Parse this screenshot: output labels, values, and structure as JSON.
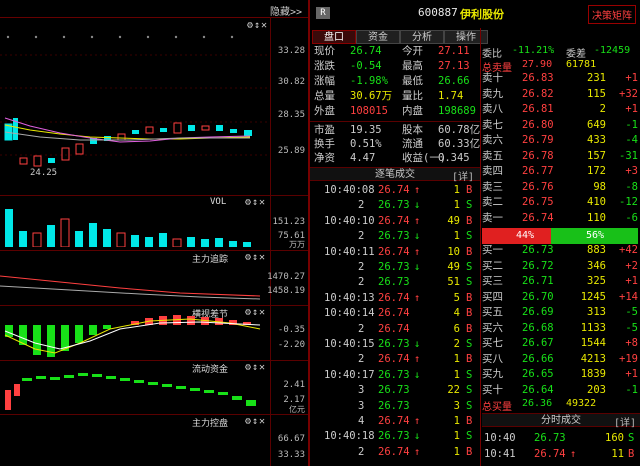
{
  "topbar": {
    "hide_label": "隐藏>>",
    "r_badge": "R",
    "stock_code": "600887",
    "stock_name": "伊利股份",
    "decision_button": "决策矩阵"
  },
  "tabs": [
    "盘口",
    "资金",
    "分析",
    "操作"
  ],
  "left": {
    "price_axis": [
      "33.28",
      "30.82",
      "28.35",
      "25.89"
    ],
    "low_marker": "24.25",
    "vol_title": "VOL",
    "vol_axis": [
      "151.23",
      "75.61"
    ],
    "vol_unit": "万万",
    "p1_title": "主力追踪",
    "p1_axis": [
      "1470.27",
      "1458.19"
    ],
    "p2_title": "横视差节",
    "p2_axis": [
      "-0.35",
      "-2.20"
    ],
    "p3_title": "流动资金",
    "p3_axis": [
      "2.41",
      "2.17"
    ],
    "p3_unit": "亿元",
    "p4_title": "主力控盘",
    "p4_axis": [
      "66.67",
      "33.33"
    ]
  },
  "quote": [
    {
      "l1": "现价",
      "v1": "26.74",
      "c1": "green",
      "l2": "今开",
      "v2": "27.11",
      "c2": "red"
    },
    {
      "l1": "涨跌",
      "v1": "-0.54",
      "c1": "green",
      "l2": "最高",
      "v2": "27.13",
      "c2": "red"
    },
    {
      "l1": "涨幅",
      "v1": "-1.98%",
      "c1": "green",
      "l2": "最低",
      "v2": "26.66",
      "c2": "green"
    },
    {
      "l1": "总量",
      "v1": "30.67万",
      "c1": "yellow",
      "l2": "量比",
      "v2": "1.74",
      "c2": "yellow"
    },
    {
      "l1": "外盘",
      "v1": "108015",
      "c1": "red",
      "l2": "内盘",
      "v2": "198689",
      "c2": "green"
    }
  ],
  "quote2": [
    {
      "l1": "市盈",
      "v1": "19.35",
      "l2": "股本",
      "v2": "60.78亿"
    },
    {
      "l1": "换手",
      "v1": "0.51%",
      "l2": "流通",
      "v2": "60.33亿"
    },
    {
      "l1": "净资",
      "v1": "4.47",
      "l2": "收益(一)",
      "v2": "0.345"
    }
  ],
  "ticks_title": "逐笔成交",
  "ticks_detail": "[详]",
  "ticks": [
    {
      "t": "10:40:08",
      "p": "26.74",
      "a": "↑",
      "v": "1",
      "s": "B",
      "pc": "red",
      "sc": "red"
    },
    {
      "t": "2",
      "p": "26.73",
      "a": "↓",
      "v": "1",
      "s": "S",
      "pc": "green",
      "sc": "green"
    },
    {
      "t": "10:40:10",
      "p": "26.74",
      "a": "↑",
      "v": "49",
      "s": "B",
      "pc": "red",
      "sc": "red"
    },
    {
      "t": "2",
      "p": "26.73",
      "a": "↓",
      "v": "1",
      "s": "S",
      "pc": "green",
      "sc": "green"
    },
    {
      "t": "10:40:11",
      "p": "26.74",
      "a": "↑",
      "v": "10",
      "s": "B",
      "pc": "red",
      "sc": "red"
    },
    {
      "t": "2",
      "p": "26.73",
      "a": "↓",
      "v": "49",
      "s": "S",
      "pc": "green",
      "sc": "green"
    },
    {
      "t": "2",
      "p": "26.73",
      "a": "",
      "v": "51",
      "s": "S",
      "pc": "green",
      "sc": "green"
    },
    {
      "t": "10:40:13",
      "p": "26.74",
      "a": "↑",
      "v": "5",
      "s": "B",
      "pc": "red",
      "sc": "red"
    },
    {
      "t": "10:40:14",
      "p": "26.74",
      "a": "",
      "v": "4",
      "s": "B",
      "pc": "red",
      "sc": "red"
    },
    {
      "t": "2",
      "p": "26.74",
      "a": "",
      "v": "6",
      "s": "B",
      "pc": "red",
      "sc": "red"
    },
    {
      "t": "10:40:15",
      "p": "26.73",
      "a": "↓",
      "v": "2",
      "s": "S",
      "pc": "green",
      "sc": "green"
    },
    {
      "t": "2",
      "p": "26.74",
      "a": "↑",
      "v": "1",
      "s": "B",
      "pc": "red",
      "sc": "red"
    },
    {
      "t": "10:40:17",
      "p": "26.73",
      "a": "↓",
      "v": "1",
      "s": "S",
      "pc": "green",
      "sc": "green"
    },
    {
      "t": "3",
      "p": "26.73",
      "a": "",
      "v": "22",
      "s": "S",
      "pc": "green",
      "sc": "green"
    },
    {
      "t": "3",
      "p": "26.73",
      "a": "",
      "v": "3",
      "s": "S",
      "pc": "green",
      "sc": "green"
    },
    {
      "t": "4",
      "p": "26.74",
      "a": "↑",
      "v": "1",
      "s": "B",
      "pc": "red",
      "sc": "red"
    },
    {
      "t": "10:40:18",
      "p": "26.73",
      "a": "↓",
      "v": "1",
      "s": "S",
      "pc": "green",
      "sc": "green"
    },
    {
      "t": "2",
      "p": "26.74",
      "a": "↑",
      "v": "1",
      "s": "B",
      "pc": "red",
      "sc": "red"
    }
  ],
  "book_header": {
    "l1": "委比",
    "v1": "-11.21%",
    "l2": "委差",
    "v2": "-12459"
  },
  "sell_total": {
    "label": "总卖量",
    "price": "27.90",
    "qty": "61781"
  },
  "sells": [
    {
      "n": "卖十",
      "p": "26.83",
      "q": "231",
      "d": "+1"
    },
    {
      "n": "卖九",
      "p": "26.82",
      "q": "115",
      "d": "+32"
    },
    {
      "n": "卖八",
      "p": "26.81",
      "q": "2",
      "d": "+1"
    },
    {
      "n": "卖七",
      "p": "26.80",
      "q": "649",
      "d": "-1"
    },
    {
      "n": "卖六",
      "p": "26.79",
      "q": "433",
      "d": "-4"
    },
    {
      "n": "卖五",
      "p": "26.78",
      "q": "157",
      "d": "-31"
    },
    {
      "n": "卖四",
      "p": "26.77",
      "q": "172",
      "d": "+3"
    },
    {
      "n": "卖三",
      "p": "26.76",
      "q": "98",
      "d": "-8"
    },
    {
      "n": "卖二",
      "p": "26.75",
      "q": "410",
      "d": "-12"
    },
    {
      "n": "卖一",
      "p": "26.74",
      "q": "110",
      "d": "-6"
    }
  ],
  "ratio": {
    "left": "44%",
    "right": "56%",
    "left_frac": 0.44
  },
  "buys": [
    {
      "n": "买一",
      "p": "26.73",
      "q": "883",
      "d": "+42"
    },
    {
      "n": "买二",
      "p": "26.72",
      "q": "346",
      "d": "+2"
    },
    {
      "n": "买三",
      "p": "26.71",
      "q": "325",
      "d": "+1"
    },
    {
      "n": "买四",
      "p": "26.70",
      "q": "1245",
      "d": "+14"
    },
    {
      "n": "买五",
      "p": "26.69",
      "q": "313",
      "d": "-5"
    },
    {
      "n": "买六",
      "p": "26.68",
      "q": "1133",
      "d": "-5"
    },
    {
      "n": "买七",
      "p": "26.67",
      "q": "1544",
      "d": "+8"
    },
    {
      "n": "买八",
      "p": "26.66",
      "q": "4213",
      "d": "+19"
    },
    {
      "n": "买九",
      "p": "26.65",
      "q": "1839",
      "d": "+1"
    },
    {
      "n": "买十",
      "p": "26.64",
      "q": "203",
      "d": "-1"
    }
  ],
  "buy_total": {
    "label": "总买量",
    "price": "26.36",
    "qty": "49322"
  },
  "minute_title": "分时成交",
  "minute_detail": "[详]",
  "minute": [
    {
      "t": "10:40",
      "p": "26.73",
      "a": "",
      "v": "160",
      "s": "S",
      "pc": "green"
    },
    {
      "t": "10:41",
      "p": "26.74",
      "a": "↑",
      "v": "11",
      "s": "B",
      "pc": "red"
    }
  ],
  "colors": {
    "up": "#ff4040",
    "down": "#18e018",
    "yellow": "#e8e800",
    "gridred": "#5a0000"
  }
}
